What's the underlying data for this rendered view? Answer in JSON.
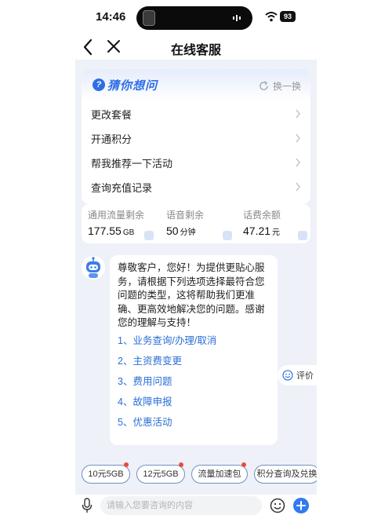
{
  "status_bar": {
    "time": "14:46",
    "battery": "93"
  },
  "nav": {
    "title": "在线客服"
  },
  "guess": {
    "title": "猜你想问",
    "refresh_label": "换一换",
    "items": [
      {
        "label": "更改套餐"
      },
      {
        "label": "开通积分"
      },
      {
        "label": "帮我推荐一下活动"
      },
      {
        "label": "查询充值记录"
      }
    ]
  },
  "balance": {
    "items": [
      {
        "label": "通用流量剩余",
        "value": "177.55",
        "unit": "GB"
      },
      {
        "label": "语音剩余",
        "value": "50",
        "unit": "分钟"
      },
      {
        "label": "话费余额",
        "value": "47.21",
        "unit": "元"
      }
    ]
  },
  "chat": {
    "message": "尊敬客户，您好！为提供更贴心服务，请根据下列选项选择最符合您问题的类型，这将帮助我们更准确、更高效地解决您的问题。感谢您的理解与支持！",
    "options": [
      {
        "label": "1、业务查询/办理/取消"
      },
      {
        "label": "2、主资费变更"
      },
      {
        "label": "3、费用问题"
      },
      {
        "label": "4、故障申报"
      },
      {
        "label": "5、优惠活动"
      }
    ]
  },
  "feedback": {
    "label": "评价"
  },
  "quick_replies": [
    {
      "label": "10元5GB"
    },
    {
      "label": "12元5GB"
    },
    {
      "label": "流量加速包"
    },
    {
      "label": "积分查询及兑换"
    }
  ],
  "input": {
    "placeholder": "请输入您要咨询的内容"
  },
  "colors": {
    "accent": "#2f6ee8",
    "link": "#2a6fd6",
    "badge": "#e94a3f",
    "background": "#eef1f8"
  }
}
